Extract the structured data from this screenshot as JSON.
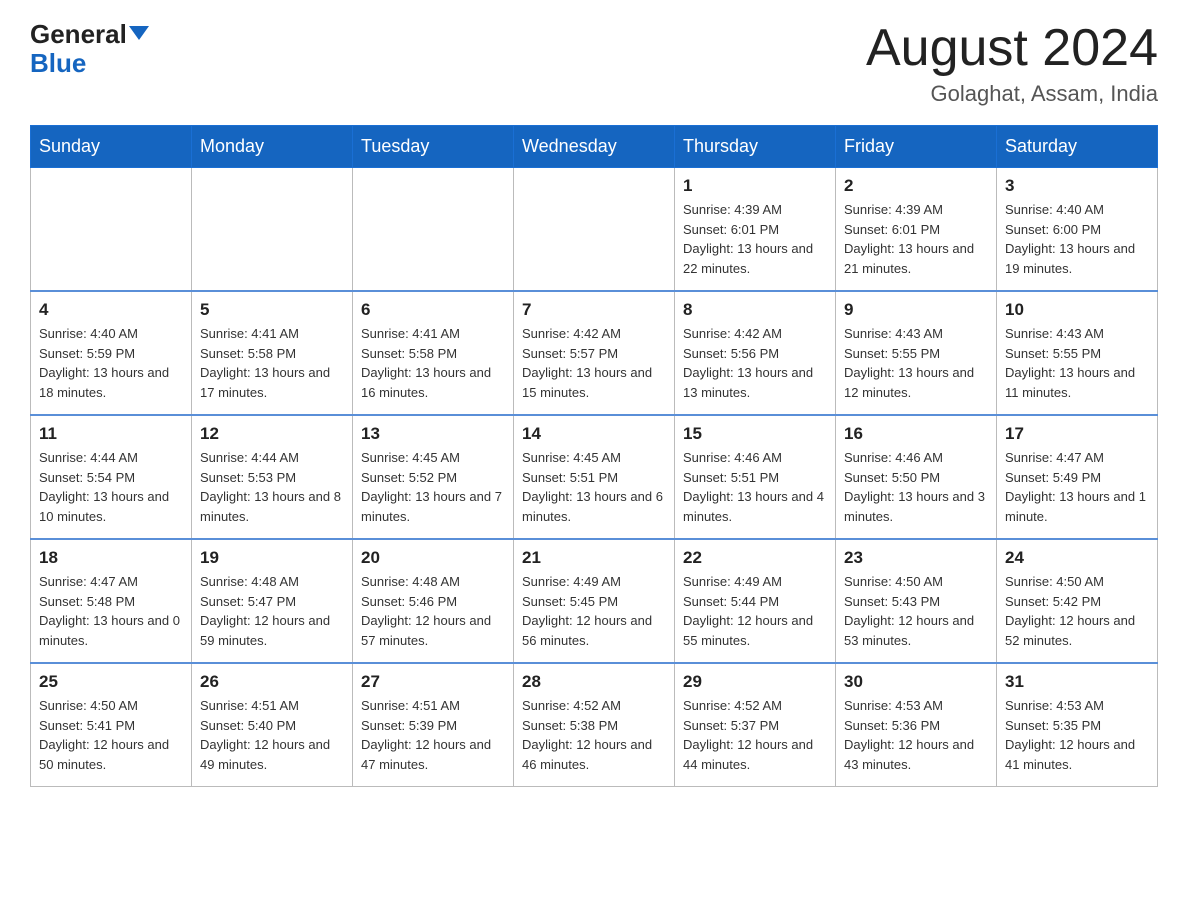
{
  "logo": {
    "general": "General",
    "blue": "Blue"
  },
  "title": "August 2024",
  "subtitle": "Golaghat, Assam, India",
  "days_of_week": [
    "Sunday",
    "Monday",
    "Tuesday",
    "Wednesday",
    "Thursday",
    "Friday",
    "Saturday"
  ],
  "weeks": [
    [
      {
        "day": "",
        "info": ""
      },
      {
        "day": "",
        "info": ""
      },
      {
        "day": "",
        "info": ""
      },
      {
        "day": "",
        "info": ""
      },
      {
        "day": "1",
        "info": "Sunrise: 4:39 AM\nSunset: 6:01 PM\nDaylight: 13 hours and 22 minutes."
      },
      {
        "day": "2",
        "info": "Sunrise: 4:39 AM\nSunset: 6:01 PM\nDaylight: 13 hours and 21 minutes."
      },
      {
        "day": "3",
        "info": "Sunrise: 4:40 AM\nSunset: 6:00 PM\nDaylight: 13 hours and 19 minutes."
      }
    ],
    [
      {
        "day": "4",
        "info": "Sunrise: 4:40 AM\nSunset: 5:59 PM\nDaylight: 13 hours and 18 minutes."
      },
      {
        "day": "5",
        "info": "Sunrise: 4:41 AM\nSunset: 5:58 PM\nDaylight: 13 hours and 17 minutes."
      },
      {
        "day": "6",
        "info": "Sunrise: 4:41 AM\nSunset: 5:58 PM\nDaylight: 13 hours and 16 minutes."
      },
      {
        "day": "7",
        "info": "Sunrise: 4:42 AM\nSunset: 5:57 PM\nDaylight: 13 hours and 15 minutes."
      },
      {
        "day": "8",
        "info": "Sunrise: 4:42 AM\nSunset: 5:56 PM\nDaylight: 13 hours and 13 minutes."
      },
      {
        "day": "9",
        "info": "Sunrise: 4:43 AM\nSunset: 5:55 PM\nDaylight: 13 hours and 12 minutes."
      },
      {
        "day": "10",
        "info": "Sunrise: 4:43 AM\nSunset: 5:55 PM\nDaylight: 13 hours and 11 minutes."
      }
    ],
    [
      {
        "day": "11",
        "info": "Sunrise: 4:44 AM\nSunset: 5:54 PM\nDaylight: 13 hours and 10 minutes."
      },
      {
        "day": "12",
        "info": "Sunrise: 4:44 AM\nSunset: 5:53 PM\nDaylight: 13 hours and 8 minutes."
      },
      {
        "day": "13",
        "info": "Sunrise: 4:45 AM\nSunset: 5:52 PM\nDaylight: 13 hours and 7 minutes."
      },
      {
        "day": "14",
        "info": "Sunrise: 4:45 AM\nSunset: 5:51 PM\nDaylight: 13 hours and 6 minutes."
      },
      {
        "day": "15",
        "info": "Sunrise: 4:46 AM\nSunset: 5:51 PM\nDaylight: 13 hours and 4 minutes."
      },
      {
        "day": "16",
        "info": "Sunrise: 4:46 AM\nSunset: 5:50 PM\nDaylight: 13 hours and 3 minutes."
      },
      {
        "day": "17",
        "info": "Sunrise: 4:47 AM\nSunset: 5:49 PM\nDaylight: 13 hours and 1 minute."
      }
    ],
    [
      {
        "day": "18",
        "info": "Sunrise: 4:47 AM\nSunset: 5:48 PM\nDaylight: 13 hours and 0 minutes."
      },
      {
        "day": "19",
        "info": "Sunrise: 4:48 AM\nSunset: 5:47 PM\nDaylight: 12 hours and 59 minutes."
      },
      {
        "day": "20",
        "info": "Sunrise: 4:48 AM\nSunset: 5:46 PM\nDaylight: 12 hours and 57 minutes."
      },
      {
        "day": "21",
        "info": "Sunrise: 4:49 AM\nSunset: 5:45 PM\nDaylight: 12 hours and 56 minutes."
      },
      {
        "day": "22",
        "info": "Sunrise: 4:49 AM\nSunset: 5:44 PM\nDaylight: 12 hours and 55 minutes."
      },
      {
        "day": "23",
        "info": "Sunrise: 4:50 AM\nSunset: 5:43 PM\nDaylight: 12 hours and 53 minutes."
      },
      {
        "day": "24",
        "info": "Sunrise: 4:50 AM\nSunset: 5:42 PM\nDaylight: 12 hours and 52 minutes."
      }
    ],
    [
      {
        "day": "25",
        "info": "Sunrise: 4:50 AM\nSunset: 5:41 PM\nDaylight: 12 hours and 50 minutes."
      },
      {
        "day": "26",
        "info": "Sunrise: 4:51 AM\nSunset: 5:40 PM\nDaylight: 12 hours and 49 minutes."
      },
      {
        "day": "27",
        "info": "Sunrise: 4:51 AM\nSunset: 5:39 PM\nDaylight: 12 hours and 47 minutes."
      },
      {
        "day": "28",
        "info": "Sunrise: 4:52 AM\nSunset: 5:38 PM\nDaylight: 12 hours and 46 minutes."
      },
      {
        "day": "29",
        "info": "Sunrise: 4:52 AM\nSunset: 5:37 PM\nDaylight: 12 hours and 44 minutes."
      },
      {
        "day": "30",
        "info": "Sunrise: 4:53 AM\nSunset: 5:36 PM\nDaylight: 12 hours and 43 minutes."
      },
      {
        "day": "31",
        "info": "Sunrise: 4:53 AM\nSunset: 5:35 PM\nDaylight: 12 hours and 41 minutes."
      }
    ]
  ]
}
